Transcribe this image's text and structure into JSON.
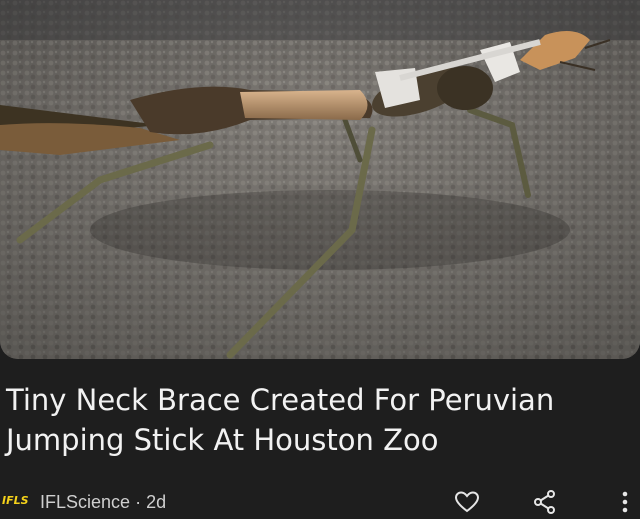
{
  "article": {
    "title": "Tiny Neck Brace Created For Peruvian Jumping Stick At Houston Zoo",
    "source_logo": "IFLS",
    "source_name": "IFLScience",
    "separator": "·",
    "age": "2d"
  },
  "icons": {
    "like": "heart-outline-icon",
    "share": "share-icon",
    "more": "more-vertical-icon"
  },
  "colors": {
    "background": "#1e1e1e",
    "logo": "#f5d21a",
    "text": "#f2f2f2",
    "meta": "#cfcfcf"
  }
}
